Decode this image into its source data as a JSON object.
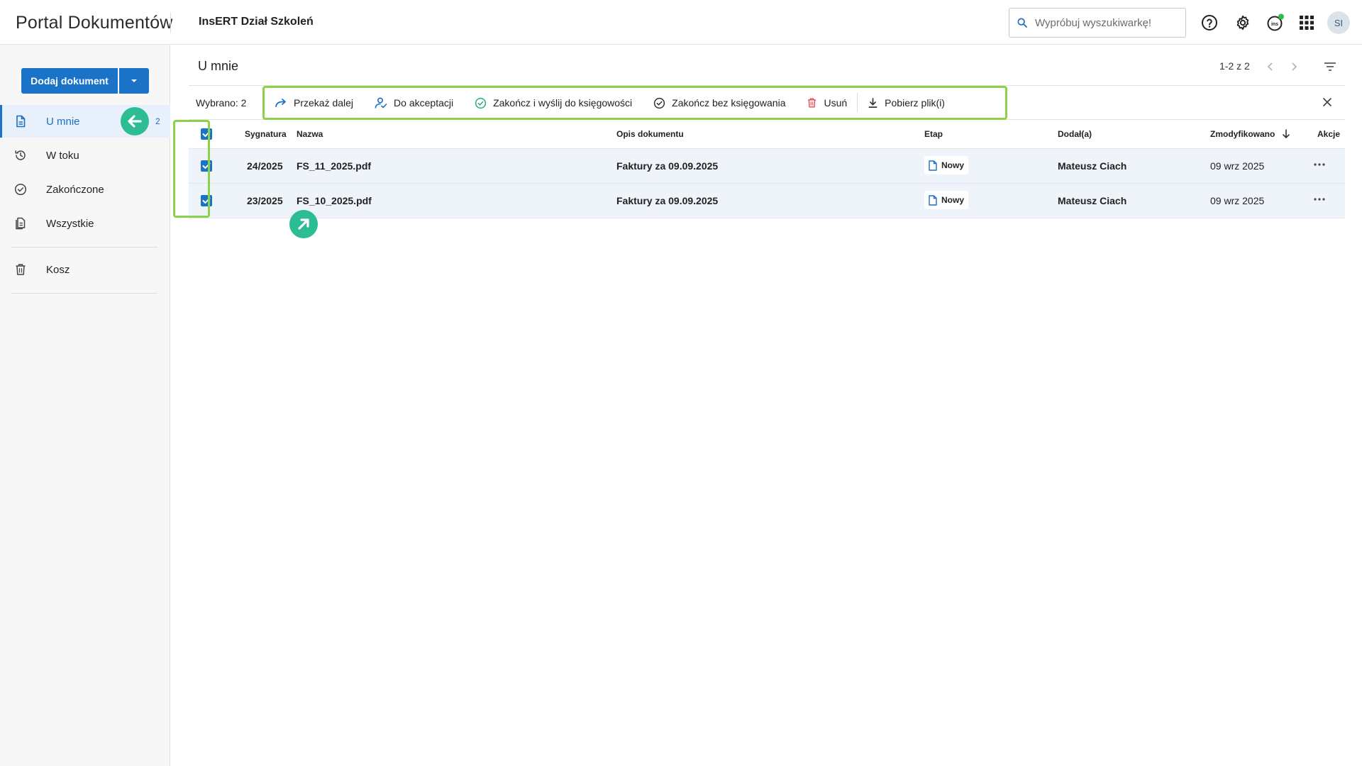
{
  "header": {
    "app_title": "Portal Dokumentów",
    "company": "InsERT Dział Szkoleń",
    "search_placeholder": "Wypróbuj wyszukiwarkę!",
    "avatar_initials": "SI"
  },
  "sidebar": {
    "add_document_label": "Dodaj dokument",
    "items": [
      {
        "label": "U mnie",
        "badge": "2",
        "active": true
      },
      {
        "label": "W toku"
      },
      {
        "label": "Zakończone"
      },
      {
        "label": "Wszystkie"
      },
      {
        "label": "Kosz"
      }
    ]
  },
  "main": {
    "title": "U mnie",
    "pager_text": "1-2 z 2",
    "selection": {
      "count_label": "Wybrano: 2",
      "actions": [
        "Przekaż dalej",
        "Do akceptacji",
        "Zakończ i wyślij do księgowości",
        "Zakończ bez księgowania",
        "Usuń",
        "Pobierz plik(i)"
      ]
    },
    "table": {
      "columns": [
        "Sygnatura",
        "Nazwa",
        "Opis dokumentu",
        "Etap",
        "Dodał(a)",
        "Zmodyfikowano",
        "Akcje"
      ],
      "rows": [
        {
          "signature": "24/2025",
          "name": "FS_11_2025.pdf",
          "description": "Faktury za 09.09.2025",
          "stage": "Nowy",
          "added_by": "Mateusz Ciach",
          "modified": "09 wrz 2025"
        },
        {
          "signature": "23/2025",
          "name": "FS_10_2025.pdf",
          "description": "Faktury za 09.09.2025",
          "stage": "Nowy",
          "added_by": "Mateusz Ciach",
          "modified": "09 wrz 2025"
        }
      ]
    }
  },
  "colors": {
    "accent": "#1a73c7",
    "highlight_border": "#8bd14a",
    "marker": "#2dbd94",
    "delete_icon": "#e0474c",
    "success_icon": "#2dab8a"
  }
}
